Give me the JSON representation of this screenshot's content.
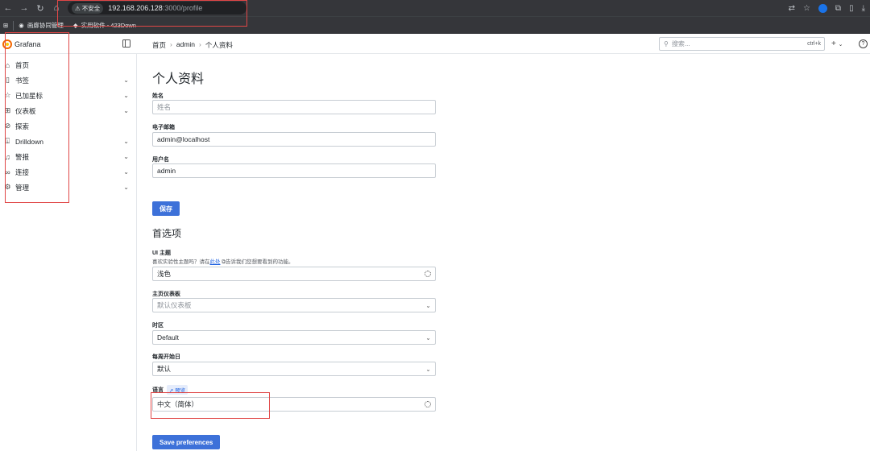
{
  "browser": {
    "insecure_label": "不安全",
    "url_host": "192.168.206.128",
    "url_path": ":3000/profile",
    "bookmarks": [
      "画廊协同管理",
      "实用软件 - 423Down"
    ]
  },
  "topbar": {
    "app_name": "Grafana",
    "breadcrumb": [
      "首页",
      "admin",
      "个人资料"
    ],
    "search_placeholder": "搜索...",
    "search_shortcut": "ctrl+k",
    "plus_label": "+"
  },
  "sidebar": {
    "items": [
      {
        "label": "首页",
        "icon": "home-icon",
        "expandable": false
      },
      {
        "label": "书签",
        "icon": "bookmark-icon",
        "expandable": true
      },
      {
        "label": "已加星标",
        "icon": "star-icon",
        "expandable": true
      },
      {
        "label": "仪表板",
        "icon": "apps-icon",
        "expandable": true
      },
      {
        "label": "探索",
        "icon": "compass-icon",
        "expandable": false
      },
      {
        "label": "Drilldown",
        "icon": "drilldown-icon",
        "expandable": true
      },
      {
        "label": "警报",
        "icon": "bell-icon",
        "expandable": true
      },
      {
        "label": "连接",
        "icon": "link-icon",
        "expandable": true
      },
      {
        "label": "管理",
        "icon": "cog-icon",
        "expandable": true
      }
    ]
  },
  "profile": {
    "title": "个人资料",
    "name_label": "姓名",
    "name_placeholder": "姓名",
    "email_label": "电子邮箱",
    "email_value": "admin@localhost",
    "username_label": "用户名",
    "username_value": "admin",
    "save_label": "保存"
  },
  "preferences": {
    "title": "首选项",
    "theme_label": "UI 主题",
    "theme_desc_before": "喜欢实验性主题吗？请在",
    "theme_desc_link": "此处",
    "theme_desc_after": "告诉我们您想要看到的功能。",
    "theme_value": "浅色",
    "home_dashboard_label": "主页仪表板",
    "home_dashboard_placeholder": "默认仪表板",
    "timezone_label": "时区",
    "timezone_value": "Default",
    "week_start_label": "每周开始日",
    "week_start_value": "默认",
    "language_label": "语言",
    "language_badge": "预览",
    "language_value": "中文（简体）",
    "save_label": "Save preferences"
  }
}
